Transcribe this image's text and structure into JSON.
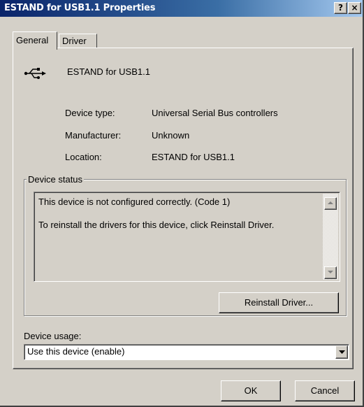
{
  "window": {
    "title": "ESTAND for USB1.1 Properties",
    "help_glyph": "?",
    "close_glyph": "×",
    "title_bar_color": "#0a246a",
    "face_color": "#d4d0c8"
  },
  "tabs": [
    {
      "label": "General",
      "selected": true
    },
    {
      "label": "Driver",
      "selected": false
    }
  ],
  "device": {
    "icon": "usb-icon",
    "name": "ESTAND for USB1.1"
  },
  "properties": [
    {
      "label": "Device type:",
      "value": "Universal Serial Bus controllers"
    },
    {
      "label": "Manufacturer:",
      "value": "Unknown"
    },
    {
      "label": "Location:",
      "value": "ESTAND for USB1.1"
    }
  ],
  "status": {
    "group_label": "Device status",
    "lines": [
      "This device is not configured correctly. (Code 1)",
      "To reinstall the drivers for this device, click Reinstall Driver."
    ],
    "reinstall_button": "Reinstall Driver..."
  },
  "usage": {
    "label": "Device usage:",
    "selected": "Use this device (enable)"
  },
  "footer": {
    "ok_label": "OK",
    "cancel_label": "Cancel"
  }
}
